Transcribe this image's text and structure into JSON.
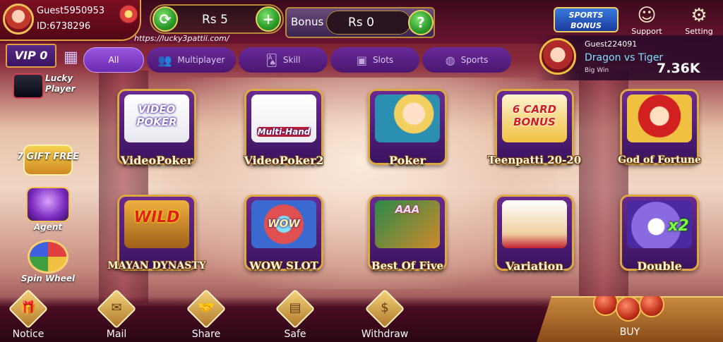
{
  "profile": {
    "name": "Guest5950953",
    "id": "ID:6738296"
  },
  "wallet": {
    "balance": "Rs  5",
    "refresh_icon": "refresh-icon",
    "add_icon": "plus-icon"
  },
  "bonus": {
    "label": "Bonus",
    "value": "Rs  0",
    "help_icon": "question-icon"
  },
  "top_right": {
    "sports_bonus": "SPORTS BONUS",
    "support": "Support",
    "setting": "Setting"
  },
  "url": "https://lucky3pattii.com/",
  "vip": {
    "label": "VIP 0"
  },
  "tabs": [
    {
      "label": "All",
      "active": true
    },
    {
      "label": "Multiplayer"
    },
    {
      "label": "Skill"
    },
    {
      "label": "Slots"
    },
    {
      "label": "Sports"
    }
  ],
  "recent_win": {
    "player": "Guest224091",
    "game": "Dragon vs Tiger",
    "tag": "Big Win",
    "amount": "7.36K"
  },
  "side_items": {
    "lucky_player": "Lucky Player",
    "seven_gift": "7 GIFT FREE",
    "agent": "Agent",
    "spin_wheel": "Spin Wheel"
  },
  "games": [
    {
      "title": "VideoPoker",
      "badge": "VIDEO POKER"
    },
    {
      "title": "VideoPoker2",
      "badge": "Multi-Hand"
    },
    {
      "title": "Poker",
      "badge": ""
    },
    {
      "title": "Teenpatti 20-20",
      "badge": "6 CARD BONUS"
    },
    {
      "title": "God of Fortune",
      "badge": ""
    },
    {
      "title": "MAYAN DYNASTY",
      "badge": "WILD"
    },
    {
      "title": "WOW SLOT",
      "badge": "WOW"
    },
    {
      "title": "Best Of Five",
      "badge": "AAA"
    },
    {
      "title": "Variation",
      "badge": ""
    },
    {
      "title": "Double",
      "badge": "x2"
    }
  ],
  "bottom_nav": [
    {
      "label": "Notice",
      "icon": "gift-box-icon"
    },
    {
      "label": "Mail",
      "icon": "envelope-icon"
    },
    {
      "label": "Share",
      "icon": "handshake-icon"
    },
    {
      "label": "Safe",
      "icon": "safe-icon"
    },
    {
      "label": "Withdraw",
      "icon": "withdraw-icon"
    }
  ],
  "buy": {
    "label": "BUY"
  }
}
